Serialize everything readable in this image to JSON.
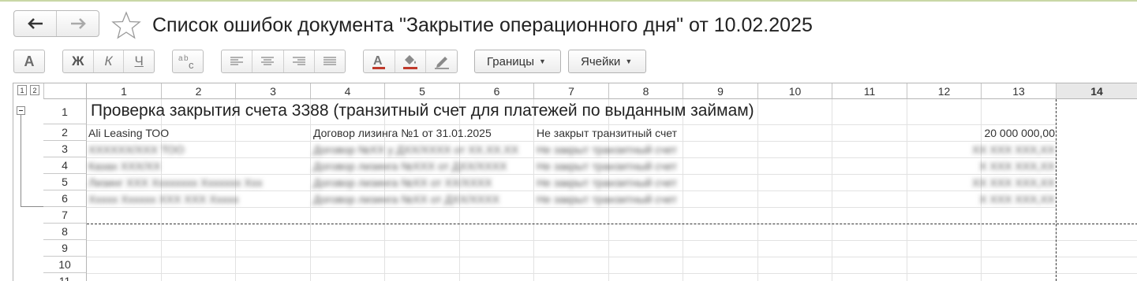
{
  "window": {
    "title": "Список ошибок документа \"Закрытие операционного дня\" от 10.02.2025",
    "back_icon": "arrow-left-icon",
    "forward_icon": "arrow-right-icon",
    "favorite_icon": "star-icon"
  },
  "toolbar": {
    "font_button": "A",
    "bold": "Ж",
    "italic": "К",
    "underline": "Ч",
    "borders_label": "Границы",
    "cells_label": "Ячейки",
    "colors": {
      "text_color": "#c0392b",
      "fill_color": "#c0392b"
    }
  },
  "sheet": {
    "level_buttons": [
      "1",
      "2"
    ],
    "columns": [
      "1",
      "2",
      "3",
      "4",
      "5",
      "6",
      "7",
      "8",
      "9",
      "10",
      "11",
      "12",
      "13",
      "14"
    ],
    "selected_column": "14",
    "rows": [
      "1",
      "2",
      "3",
      "4",
      "5",
      "6",
      "7",
      "8",
      "9",
      "10",
      "11"
    ],
    "header_text": "Проверка закрытия счета 3388 (транзитный счет для платежей по выданным займам)",
    "first_record": {
      "company": "Ali Leasing ТОО",
      "contract": "Договор лизинга №1 от 31.01.2025",
      "error": "Не закрыт транзитный счет",
      "amount": "20 000 000,00"
    },
    "hidden_records": [
      {
        "company": "ХХХХХХ/ХХХ ТОО",
        "contract": "Договор №ХХ у ДХХ/ХХХХ от ХХ.ХХ.ХХ",
        "error": "Не закрыт транзитный счет",
        "amount": "ХХ ХХХ ХХХ,ХХ"
      },
      {
        "company": "Казах ХХХ/ХХ",
        "contract": "Договор лизинга №ХХХ от ДХХ/ХХХХ",
        "error": "Не закрыт транзитный счет",
        "amount": "Х ХХХ ХХХ,ХХ"
      },
      {
        "company": "Лизинг ХХХ Хххххххх Ххххххх Ххх",
        "contract": "Договор лизинга №ХХ от ХХ/ХХХХ",
        "error": "Не закрыт транзитный счет",
        "amount": "ХХ ХХХ ХХХ,ХХ"
      },
      {
        "company": "Ххххх Хххххх ХХХ ХХХ Ххххх",
        "contract": "Договор лизинга №ХХ от ДХХ/ХХХХ",
        "error": "Не закрыт транзитный счет",
        "amount": "Х ХХХ ХХХ,ХХ"
      }
    ]
  }
}
